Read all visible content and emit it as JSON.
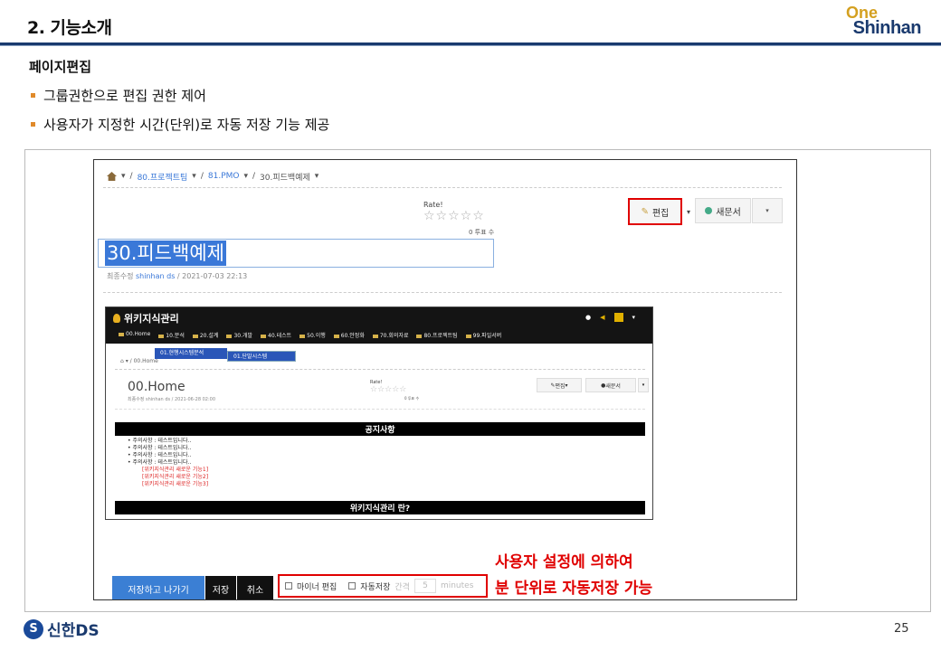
{
  "slide": {
    "title": "2. 기능소개",
    "logo_one": "One",
    "logo_shinhan": "Shinhan",
    "section_heading": "페이지편집",
    "bullets": [
      "그룹권한으로 편집 권한 제어",
      "사용자가 지정한 시간(단위)로 자동 저장 기능 제공"
    ],
    "callout_line1": "사용자 설정에 의하여",
    "callout_line2": "분 단위로 자동저장 가능",
    "footer_logo": "신한DS",
    "page_number": "25"
  },
  "editor": {
    "breadcrumb": [
      "80.프로젝트팀",
      "81.PMO",
      "30.피드백예제"
    ],
    "rate_label": "Rate!",
    "stars": "☆☆☆☆☆",
    "votes": "0 투표 수",
    "edit_button": "편집",
    "new_doc_button": "새문서",
    "title_value": "30.피드백예제",
    "modified_label": "최종수정",
    "modified_by": "shinhan ds",
    "modified_at": "/ 2021-07-03 22:13",
    "save_exit_button": "저장하고 나가기",
    "save_button": "저장",
    "cancel_button": "취소",
    "minor_edit_label": "마이너 편집",
    "autosave_label": "자동저장",
    "interval_label": "간격",
    "minutes_value": "5",
    "minutes_label": "minutes"
  },
  "inner": {
    "brand": "위키지식관리",
    "nav": [
      "00.Home",
      "10.분석",
      "20.설계",
      "30.개발",
      "40.테스트",
      "50.이행",
      "60.안정화",
      "70.회의자료",
      "80.프로젝트팀",
      "99.파일서버"
    ],
    "dropdown1": "01.현행시스템분석",
    "dropdown2": "01.단말시스템",
    "breadcrumb": "00.Home",
    "page_title": "00.Home",
    "meta": "최종수정 shinhan ds / 2021-06-28 02:00",
    "rate_label": "Rate!",
    "stars": "☆☆☆☆☆",
    "votes": "0 투표 수",
    "edit_button": "편집",
    "new_button": "새문서",
    "notice_banner": "공지사항",
    "notices": [
      "주의사항 : 테스트입니다..",
      "주의사항 : 테스트입니다..",
      "주의사항 : 테스트입니다..",
      "주의사항 : 테스트입니다.."
    ],
    "red_items": [
      "[위키지식관리 새로운 기능1]",
      "[위키지식관리 새로운 기능2]",
      "[위키지식관리 새로운 기능3]"
    ],
    "wiki_banner": "위키지식관리 란?"
  },
  "colors": {
    "accent_red": "#e00000",
    "brand_navy": "#1a3a6e",
    "button_blue": "#3b7fd4",
    "bullet_orange": "#e08a2a"
  }
}
